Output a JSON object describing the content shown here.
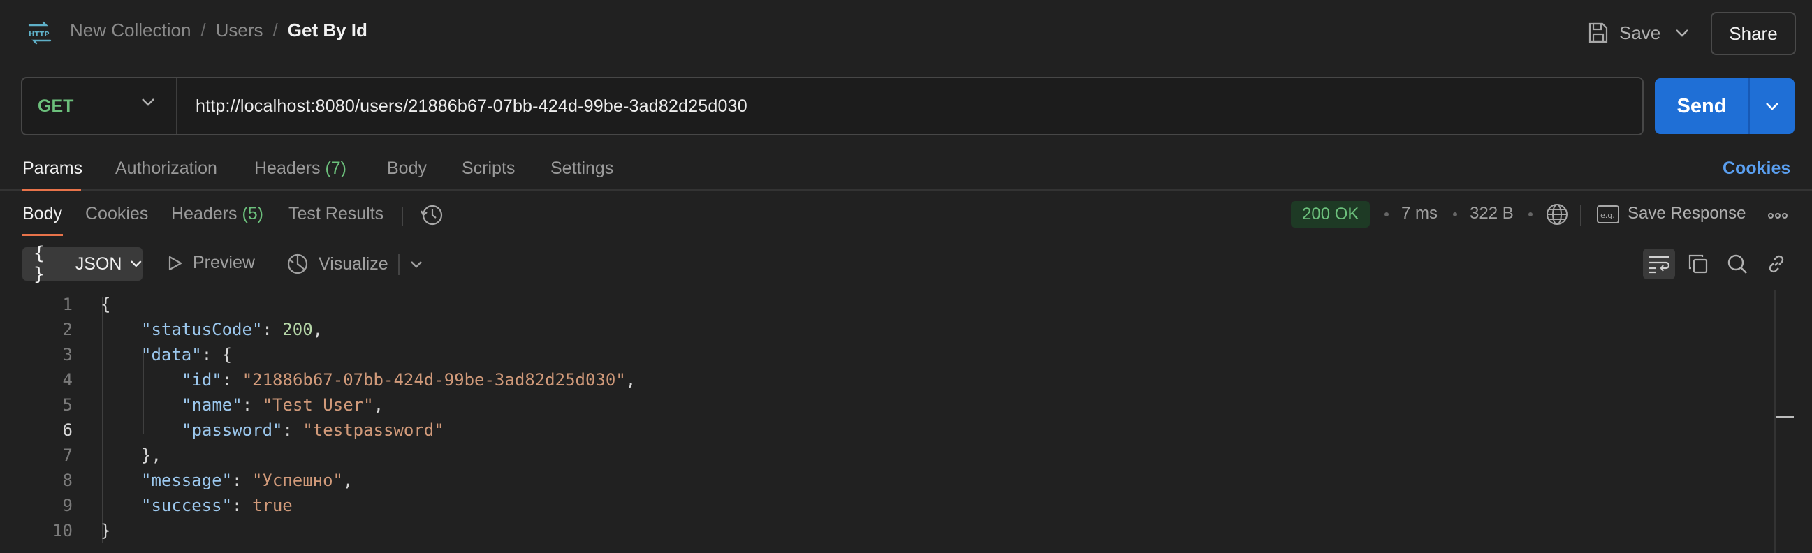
{
  "header": {
    "app_icon": "http-icon",
    "breadcrumb": [
      "New Collection",
      "Users",
      "Get By Id"
    ],
    "separator": "/",
    "save_label": "Save",
    "share_label": "Share"
  },
  "request": {
    "method": "GET",
    "url": "http://localhost:8080/users/21886b67-07bb-424d-99be-3ad82d25d030",
    "send_label": "Send"
  },
  "request_tabs": {
    "items": [
      {
        "label": "Params",
        "active": true
      },
      {
        "label": "Authorization"
      },
      {
        "label": "Headers",
        "count": "(7)"
      },
      {
        "label": "Body"
      },
      {
        "label": "Scripts"
      },
      {
        "label": "Settings"
      }
    ],
    "cookies_label": "Cookies"
  },
  "response_tabs": {
    "items": [
      {
        "label": "Body",
        "active": true
      },
      {
        "label": "Cookies"
      },
      {
        "label": "Headers",
        "count": "(5)"
      },
      {
        "label": "Test Results"
      }
    ],
    "status": "200 OK",
    "time": "7 ms",
    "size": "322 B",
    "save_response_label": "Save Response"
  },
  "response_toolbar": {
    "format": "JSON",
    "format_braces": "{ }",
    "preview_label": "Preview",
    "visualize_label": "Visualize"
  },
  "response_body": {
    "line_numbers": [
      "1",
      "2",
      "3",
      "4",
      "5",
      "6",
      "7",
      "8",
      "9",
      "10"
    ],
    "current_line": "6",
    "lines": [
      {
        "text": "{"
      },
      {
        "key": "\"statusCode\"",
        "sep": ": ",
        "num": "200",
        "tail": ","
      },
      {
        "key": "\"data\"",
        "sep": ": ",
        "tail": "{"
      },
      {
        "key": "\"id\"",
        "sep": ": ",
        "str": "\"21886b67-07bb-424d-99be-3ad82d25d030\"",
        "tail": ","
      },
      {
        "key": "\"name\"",
        "sep": ": ",
        "str": "\"Test User\"",
        "tail": ","
      },
      {
        "key": "\"password\"",
        "sep": ": ",
        "str": "\"testpassword\""
      },
      {
        "text": "},"
      },
      {
        "key": "\"message\"",
        "sep": ": ",
        "str": "\"Успешно\"",
        "tail": ","
      },
      {
        "key": "\"success\"",
        "sep": ": ",
        "bool": "true"
      },
      {
        "text": "}"
      }
    ]
  },
  "colors": {
    "background": "#212121",
    "accent_orange": "#e8734a",
    "send_blue": "#1f6fd6",
    "get_green": "#6cc07c",
    "link_blue": "#5a9ff0"
  }
}
